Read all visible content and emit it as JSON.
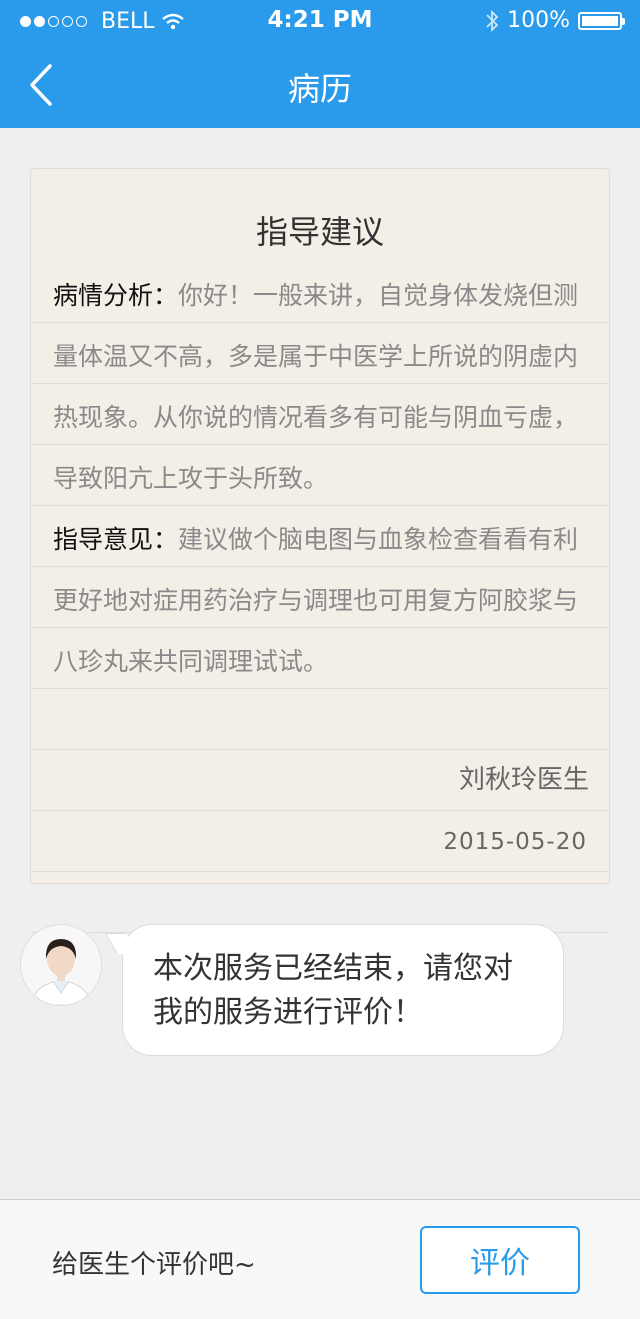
{
  "status_bar": {
    "carrier": "BELL",
    "time": "4:21 PM",
    "battery": "100%"
  },
  "nav": {
    "title": "病历"
  },
  "record": {
    "title": "指导建议",
    "analysis_label": "病情分析：",
    "analysis_text": "你好！一般来讲，自觉身体发烧但测量体温又不高，多是属于中医学上所说的阴虚内热现象。从你说的情况看多有可能与阴血亏虚，导致阳亢上攻于头所致。",
    "advice_label": "指导意见：",
    "advice_text": "建议做个脑电图与血象检查看看有利更好地对症用药治疗与调理也可用复方阿胶浆与八珍丸来共同调理试试。",
    "doctor": "刘秋玲医生",
    "date": "2015-05-20"
  },
  "chat": {
    "message": "本次服务已经结束，请您对我的服务进行评价！"
  },
  "bottom_bar": {
    "hint": "给医生个评价吧~",
    "rate_button": "评价"
  },
  "colors": {
    "primary": "#2a9bea",
    "paper": "#f3efe6"
  }
}
